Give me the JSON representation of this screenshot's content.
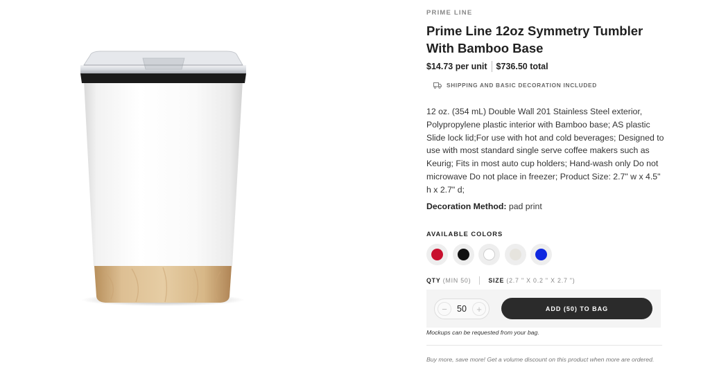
{
  "product": {
    "brand": "PRIME LINE",
    "title": "Prime Line 12oz Symmetry Tumbler With Bamboo Base",
    "price_per_unit": "$14.73 per unit",
    "price_total": "$736.50 total",
    "shipping_note": "SHIPPING AND BASIC DECORATION INCLUDED",
    "shipping_icon": "truck-icon",
    "description": "12 oz. (354 mL) Double Wall 201 Stainless Steel exterior, Polypropylene plastic interior with Bamboo base; AS plastic Slide lock lid;For use with hot and cold beverages; Designed to use with most standard single serve coffee makers such as Keurig; Fits in most auto cup holders; Hand-wash only Do not microwave Do not place in freezer; Product Size: 2.7\" w x 4.5\" h x 2.7\" d;",
    "decoration_label": "Decoration Method:",
    "decoration_value": "pad print"
  },
  "colors": {
    "label": "AVAILABLE COLORS",
    "swatches": [
      {
        "name": "red",
        "hex": "#c8102e"
      },
      {
        "name": "black",
        "hex": "#111111"
      },
      {
        "name": "white",
        "hex": "#ffffff"
      },
      {
        "name": "light-gray",
        "hex": "#e6e4de"
      },
      {
        "name": "blue",
        "hex": "#1028e0"
      }
    ]
  },
  "order": {
    "qty_label": "QTY",
    "qty_min": "(MIN 50)",
    "size_label": "SIZE",
    "size_value": "(2.7 \" X 0.2 \" X 2.7 \")",
    "quantity": "50",
    "minus": "−",
    "plus": "+",
    "add_button": "ADD (50) TO BAG",
    "mockups_note": "Mockups can be requested from your bag.",
    "volume_note": "Buy more, save more! Get a volume discount on this product when more are ordered."
  }
}
